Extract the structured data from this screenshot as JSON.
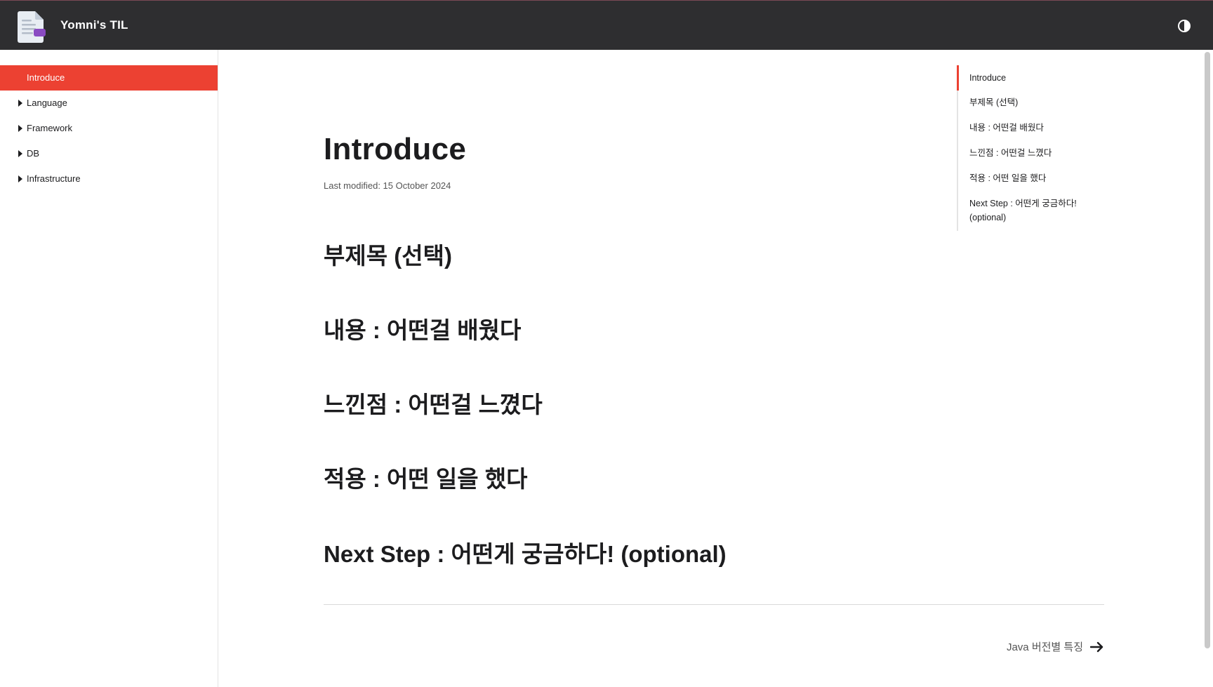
{
  "header": {
    "site_title": "Yomni's TIL",
    "logo_icon": "document-icon",
    "theme_toggle_icon": "contrast-icon"
  },
  "sidebar": {
    "items": [
      {
        "label": "Introduce",
        "active": true,
        "expandable": false
      },
      {
        "label": "Language",
        "active": false,
        "expandable": true
      },
      {
        "label": "Framework",
        "active": false,
        "expandable": true
      },
      {
        "label": "DB",
        "active": false,
        "expandable": true
      },
      {
        "label": "Infrastructure",
        "active": false,
        "expandable": true
      }
    ]
  },
  "main": {
    "title": "Introduce",
    "last_modified": "Last modified: 15 October 2024",
    "headings": [
      "부제목 (선택)",
      "내용 : 어떤걸 배웠다",
      "느낀점 : 어떤걸 느꼈다",
      "적용 : 어떤 일을 했다",
      "Next Step : 어떤게 궁금하다! (optional)"
    ],
    "next_page": {
      "label": "Java 버전별 특징",
      "icon": "arrow-right-icon"
    }
  },
  "toc": {
    "items": [
      "Introduce",
      "부제목 (선택)",
      "내용 : 어떤걸 배웠다",
      "느낀점 : 어떤걸 느꼈다",
      "적용 : 어떤 일을 했다",
      "Next Step : 어떤게 궁금하다! (optional)"
    ],
    "active_index": 0
  },
  "colors": {
    "accent": "#ec4132",
    "header_bg": "#2e2e30"
  }
}
